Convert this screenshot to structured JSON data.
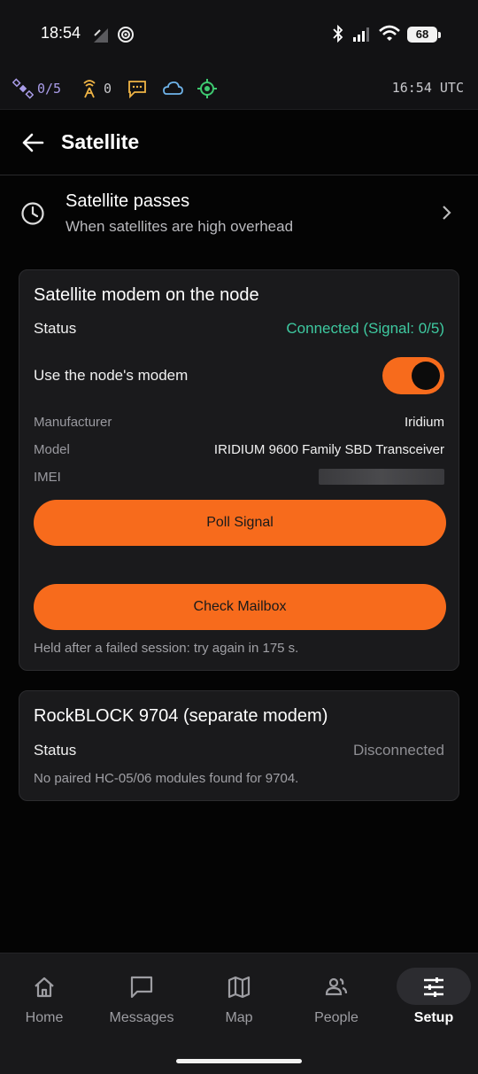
{
  "status_bar": {
    "time": "18:54",
    "battery": "68"
  },
  "info_bar": {
    "satellites": "0/5",
    "relays": "0",
    "utc_time": "16:54 UTC"
  },
  "app_bar": {
    "title": "Satellite"
  },
  "passes": {
    "title": "Satellite passes",
    "subtitle": "When satellites are high overhead"
  },
  "modem_card": {
    "title": "Satellite modem on the node",
    "status_label": "Status",
    "status_value": "Connected (Signal: 0/5)",
    "use_modem_label": "Use the node's modem",
    "use_modem_on": true,
    "manufacturer_label": "Manufacturer",
    "manufacturer_value": "Iridium",
    "model_label": "Model",
    "model_value": "IRIDIUM 9600 Family SBD Transceiver",
    "imei_label": "IMEI",
    "poll_button": "Poll Signal",
    "mailbox_button": "Check Mailbox",
    "note": "Held after a failed session: try again in 175 s."
  },
  "rockblock_card": {
    "title": "RockBLOCK 9704 (separate modem)",
    "status_label": "Status",
    "status_value": "Disconnected",
    "note": "No paired HC-05/06 modules found for 9704."
  },
  "bottom_nav": {
    "items": [
      {
        "label": "Home",
        "icon": "home-icon"
      },
      {
        "label": "Messages",
        "icon": "message-icon"
      },
      {
        "label": "Map",
        "icon": "map-icon"
      },
      {
        "label": "People",
        "icon": "people-icon"
      },
      {
        "label": "Setup",
        "icon": "sliders-icon",
        "active": true
      }
    ]
  },
  "colors": {
    "accent": "#f76b1c",
    "connected": "#3ec9a0",
    "background": "#040404",
    "card": "#1a1a1c"
  }
}
